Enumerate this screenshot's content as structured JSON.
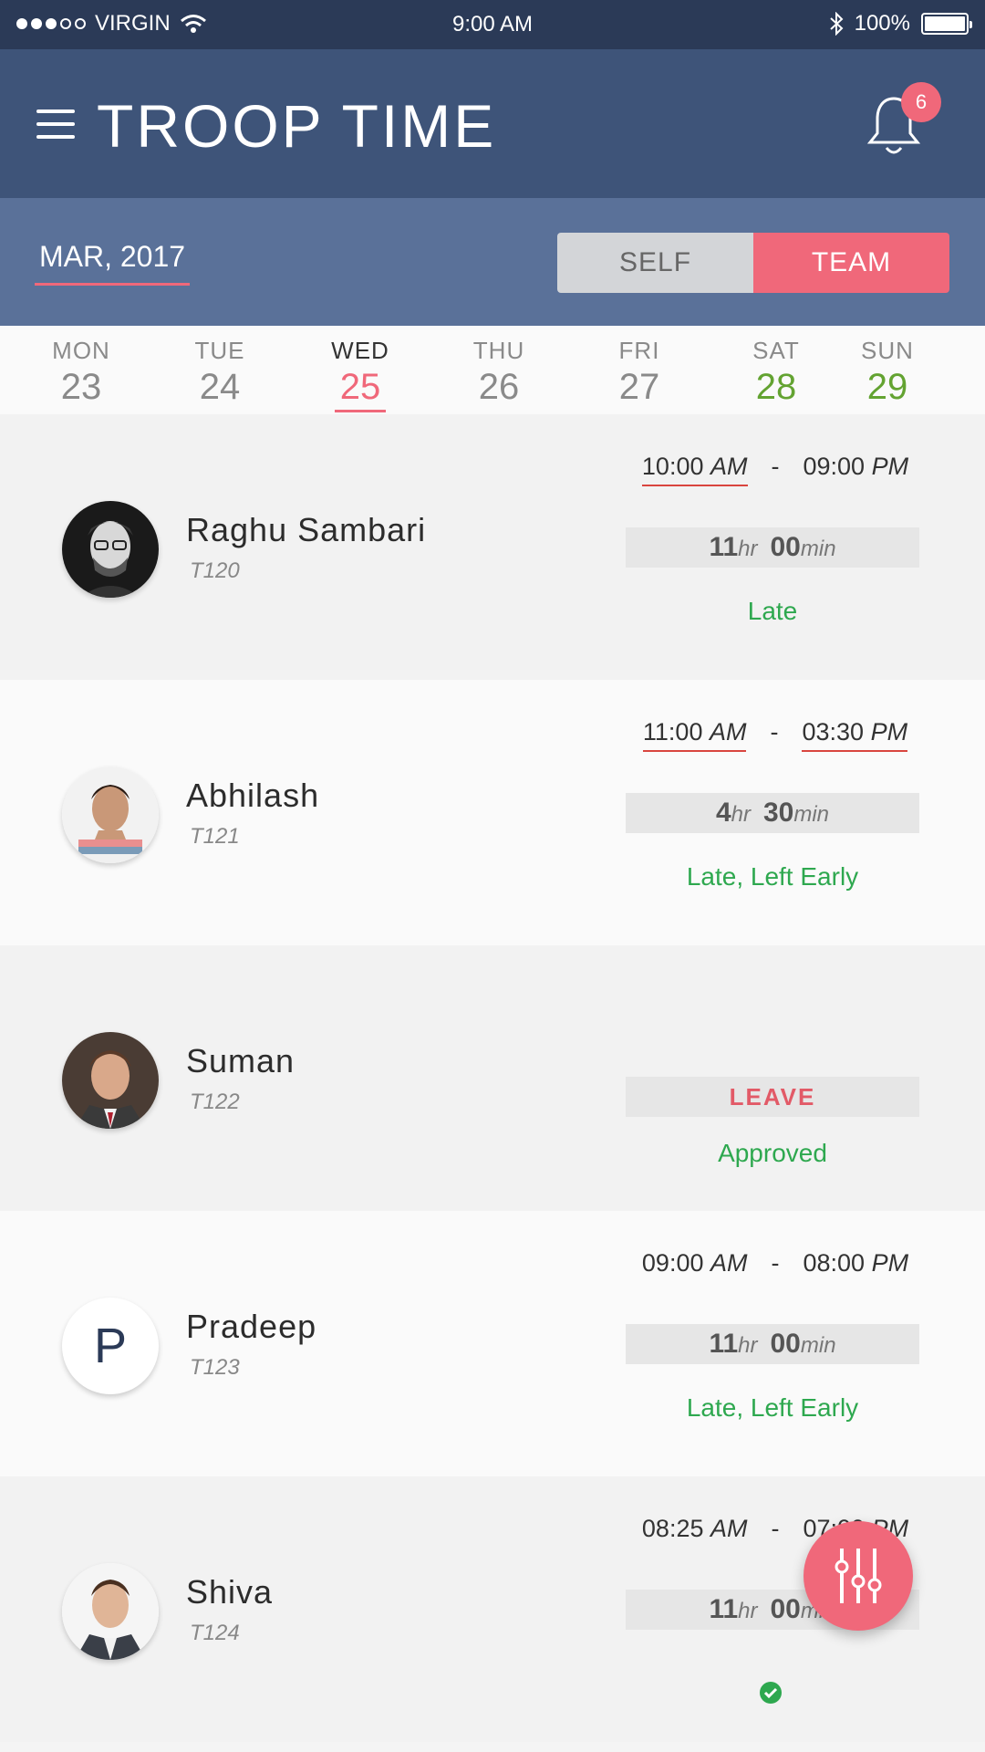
{
  "status_bar": {
    "carrier": "VIRGIN",
    "time": "9:00 AM",
    "battery": "100%"
  },
  "header": {
    "title": "TROOP TIME",
    "notification_count": "6"
  },
  "subheader": {
    "month": "MAR, 2017",
    "toggle": {
      "self": "SELF",
      "team": "TEAM",
      "selected": "TEAM"
    }
  },
  "days": [
    {
      "name": "MON",
      "date": "23"
    },
    {
      "name": "TUE",
      "date": "24"
    },
    {
      "name": "WED",
      "date": "25"
    },
    {
      "name": "THU",
      "date": "26"
    },
    {
      "name": "FRI",
      "date": "27"
    },
    {
      "name": "SAT",
      "date": "28"
    },
    {
      "name": "SUN",
      "date": "29"
    }
  ],
  "selected_day": "25",
  "employees": [
    {
      "name": "Raghu Sambari",
      "code": "T120",
      "start": "10:00",
      "start_period": "AM",
      "end": "09:00",
      "end_period": "PM",
      "hours": "11",
      "hr_unit": "hr",
      "minutes": "00",
      "min_unit": "min",
      "status": "Late"
    },
    {
      "name": "Abhilash",
      "code": "T121",
      "start": "11:00",
      "start_period": "AM",
      "end": "03:30",
      "end_period": "PM",
      "hours": "4",
      "hr_unit": "hr",
      "minutes": "30",
      "min_unit": "min",
      "status": "Late, Left Early"
    },
    {
      "name": "Suman",
      "code": "T122",
      "leave": "LEAVE",
      "status": "Approved"
    },
    {
      "name": "Pradeep",
      "code": "T123",
      "initial": "P",
      "start": "09:00",
      "start_period": "AM",
      "end": "08:00",
      "end_period": "PM",
      "hours": "11",
      "hr_unit": "hr",
      "minutes": "00",
      "min_unit": "min",
      "status": "Late, Left Early"
    },
    {
      "name": "Shiva",
      "code": "T124",
      "start": "08:25",
      "start_period": "AM",
      "end": "07:00",
      "end_period": "PM",
      "hours": "11",
      "hr_unit": "hr",
      "minutes": "00",
      "min_unit": "min"
    }
  ],
  "colors": {
    "header": "#3e5479",
    "subheader": "#5a7199",
    "accent": "#f0687a",
    "success": "#2ea84f",
    "weekend": "#63a331"
  }
}
